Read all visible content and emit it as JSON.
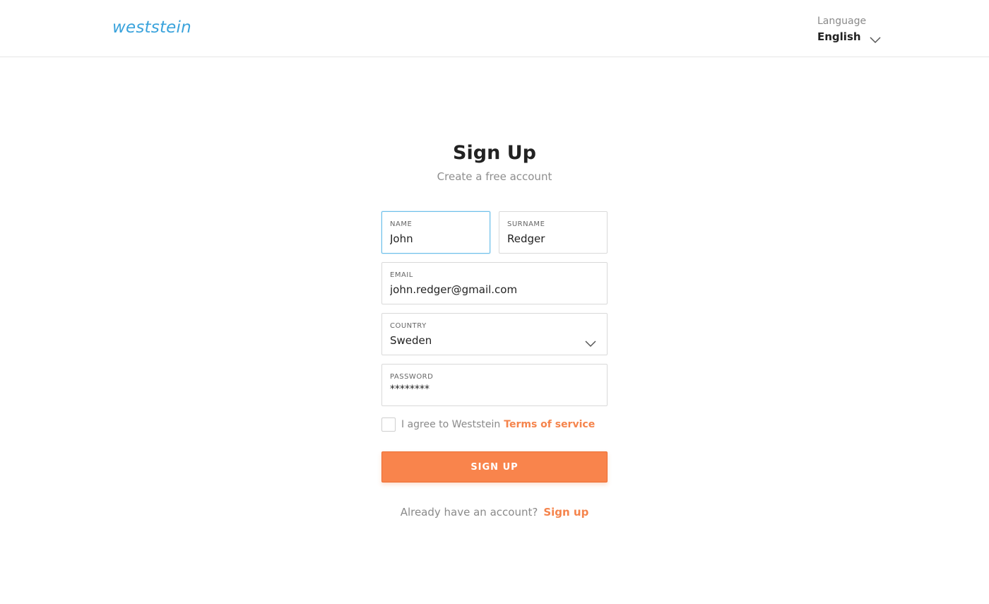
{
  "header": {
    "logo": "weststein",
    "language_label": "Language",
    "language_value": "English"
  },
  "main": {
    "title": "Sign Up",
    "subtitle": "Create a free account"
  },
  "form": {
    "name": {
      "label": "NAME",
      "value": "John"
    },
    "surname": {
      "label": "SURNAME",
      "value": "Redger"
    },
    "email": {
      "label": "EMAIL",
      "value": "john.redger@gmail.com"
    },
    "country": {
      "label": "COUNTRY",
      "value": "Sweden"
    },
    "password": {
      "label": "PASSWORD",
      "value": "********"
    },
    "agree_text": "I agree to Weststein",
    "terms_link": "Terms of service",
    "agree_checked": false,
    "submit_label": "SIGN UP"
  },
  "footer": {
    "prompt": "Already have an account?",
    "link": "Sign up"
  },
  "colors": {
    "brand": "#3aa3dc",
    "accent": "#f9844c",
    "focus": "#6fc0ea"
  },
  "icons": {
    "language_dropdown": "chevron-down-icon",
    "country_dropdown": "chevron-down-icon"
  }
}
